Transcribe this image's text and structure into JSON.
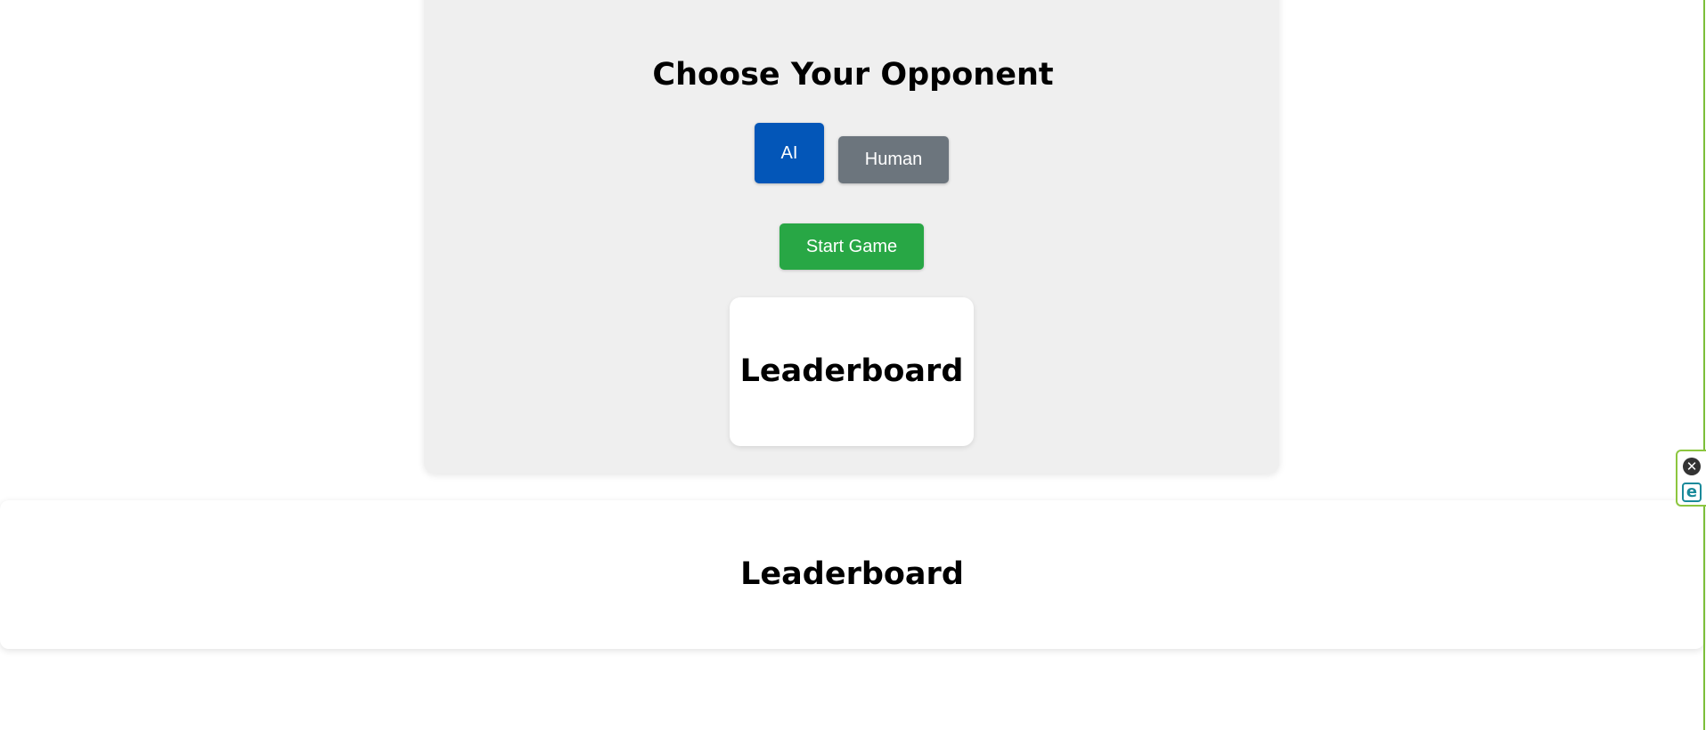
{
  "opponent_panel": {
    "title": "Choose Your Opponent",
    "ai_button_label": "AI",
    "human_button_label": "Human",
    "start_button_label": "Start Game",
    "leaderboard_title": "Leaderboard"
  },
  "leaderboard_section": {
    "title": "Leaderboard"
  },
  "extension_widget": {
    "close_icon": "close-circle-icon",
    "close_glyph": "✕",
    "logo_icon": "e-logo-icon",
    "logo_glyph": "e"
  },
  "colors": {
    "ai_button": "#0356b8",
    "human_button": "#6c757d",
    "start_button": "#28a745",
    "panel_bg": "#efefef"
  }
}
